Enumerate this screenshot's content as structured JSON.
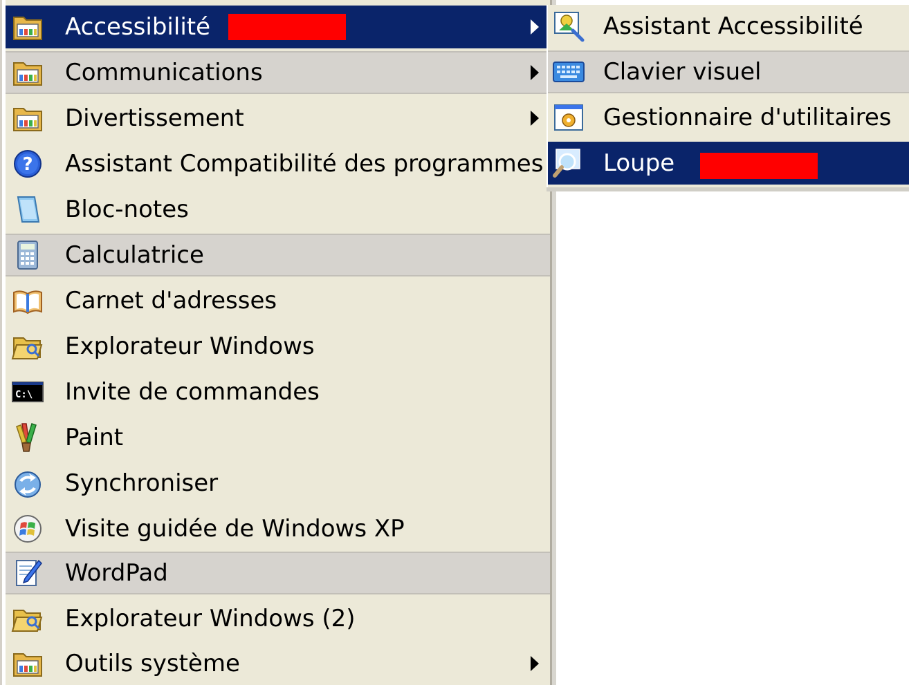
{
  "main_menu": {
    "items": [
      {
        "label": "Accessibilité",
        "icon": "program-group-icon",
        "submenu": true
      },
      {
        "label": "Communications",
        "icon": "program-group-icon",
        "submenu": true
      },
      {
        "label": "Divertissement",
        "icon": "program-group-icon",
        "submenu": true
      },
      {
        "label": "Assistant Compatibilité des programmes",
        "icon": "help-question-icon"
      },
      {
        "label": "Bloc-notes",
        "icon": "notepad-icon"
      },
      {
        "label": "Calculatrice",
        "icon": "calculator-icon"
      },
      {
        "label": "Carnet d'adresses",
        "icon": "address-book-icon"
      },
      {
        "label": "Explorateur Windows",
        "icon": "explorer-folder-icon"
      },
      {
        "label": "Invite de commandes",
        "icon": "command-prompt-icon"
      },
      {
        "label": "Paint",
        "icon": "paint-brush-icon"
      },
      {
        "label": "Synchroniser",
        "icon": "synchronize-icon"
      },
      {
        "label": "Visite guidée de Windows XP",
        "icon": "windows-tour-icon"
      },
      {
        "label": "WordPad",
        "icon": "wordpad-icon"
      },
      {
        "label": "Explorateur Windows (2)",
        "icon": "explorer-folder-icon"
      },
      {
        "label": "Outils système",
        "icon": "program-group-icon",
        "submenu": true
      }
    ],
    "cmd_icon_text": "C:\\"
  },
  "sub_menu": {
    "items": [
      {
        "label": "Assistant Accessibilité",
        "icon": "accessibility-wizard-icon"
      },
      {
        "label": "Clavier visuel",
        "icon": "on-screen-keyboard-icon"
      },
      {
        "label": "Gestionnaire d'utilitaires",
        "icon": "utility-manager-icon"
      },
      {
        "label": "Loupe",
        "icon": "magnifier-icon"
      }
    ]
  },
  "colors": {
    "menu_bg": "#ece9d8",
    "selected_bg": "#0a246a",
    "shaded_bg": "#d6d3ce",
    "redaction": "#ff0000"
  }
}
